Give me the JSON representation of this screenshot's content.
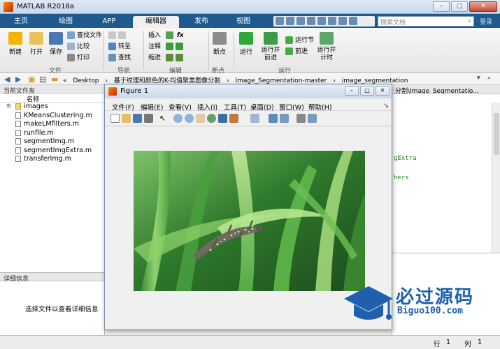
{
  "window": {
    "title": "MATLAB R2018a",
    "min": "–",
    "max": "□",
    "close": "✕"
  },
  "tabs": [
    {
      "label": "主页"
    },
    {
      "label": "绘图"
    },
    {
      "label": "APP"
    },
    {
      "label": "编辑器"
    },
    {
      "label": "发布"
    },
    {
      "label": "视图"
    }
  ],
  "search": {
    "placeholder": "搜索文档"
  },
  "login": "登录",
  "ribbon": {
    "file": {
      "new": "新建",
      "open": "打开",
      "save": "保存",
      "find_files": "查找文件",
      "compare": "比较",
      "print": "打印",
      "group": "文件"
    },
    "nav": {
      "goto": "转至",
      "find": "查找",
      "group": "导航"
    },
    "edit": {
      "insert": "插入",
      "comment": "注释",
      "indent": "缩进",
      "group": "编辑"
    },
    "breakpoints": {
      "label": "断点",
      "group": "断点"
    },
    "run": {
      "run": "运行",
      "run_advance": "运行并前进",
      "run_section": "运行节",
      "advance": "前进",
      "run_time": "运行并计时",
      "group": "运行"
    }
  },
  "address": {
    "segments": [
      "«",
      "Desktop",
      "›",
      "基于纹理和颜色的K-均值聚类图像分割",
      "›",
      "Image_Segmentation-master",
      "›",
      "image_segmentation"
    ]
  },
  "current_folder": {
    "title": "当前文件夹",
    "column": "名称",
    "items": [
      {
        "name": "images",
        "type": "folder"
      },
      {
        "name": "KMeansClustering.m",
        "type": "m"
      },
      {
        "name": "makeLMfilters.m",
        "type": "m"
      },
      {
        "name": "runfile.m",
        "type": "m"
      },
      {
        "name": "segmentImg.m",
        "type": "m"
      },
      {
        "name": "segmentImgExtra.m",
        "type": "m"
      },
      {
        "name": "transferImg.m",
        "type": "m"
      }
    ]
  },
  "details": {
    "title": "详细信息",
    "message": "选择文件以查看详细信息"
  },
  "editor": {
    "header": "分割\\Image_Segmentatio...",
    "code_fragments": [
      "gExtra",
      "hers"
    ]
  },
  "status": {
    "row_label": "行",
    "row_value": "1",
    "col_label": "列",
    "col_value": "1"
  },
  "figure": {
    "title": "Figure 1",
    "menu": [
      "文件(F)",
      "编辑(E)",
      "查看(V)",
      "插入(I)",
      "工具(T)",
      "桌面(D)",
      "窗口(W)",
      "帮助(H)"
    ]
  },
  "watermark": {
    "text": "必过源码",
    "sub": "Biguo100.com"
  },
  "colors": {
    "tab_bar": "#1e5a8e",
    "accent": "#1f5fad",
    "leaf": "#5cb84a"
  }
}
